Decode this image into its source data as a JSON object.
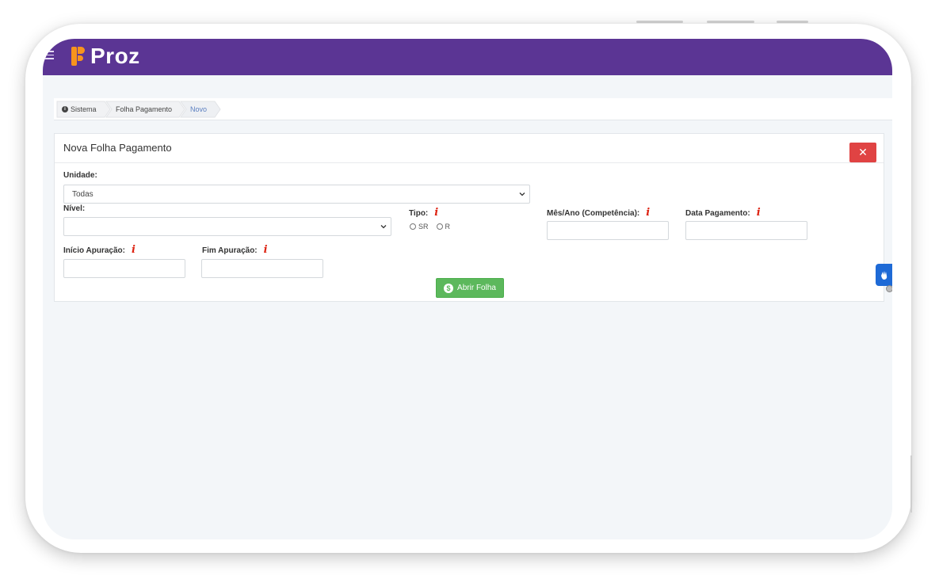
{
  "app": {
    "logo_text": "Proz"
  },
  "breadcrumb": {
    "items": [
      "Sistema",
      "Folha Pagamento",
      "Novo"
    ]
  },
  "form": {
    "title": "Nova Folha Pagamento",
    "close_label": "✕",
    "unidade": {
      "label": "Unidade:",
      "value": "Todas"
    },
    "nivel": {
      "label": "Nível:",
      "value": ""
    },
    "tipo": {
      "label": "Tipo:",
      "options": [
        "SR",
        "R"
      ]
    },
    "mes_ano": {
      "label": "Mês/Ano (Competência):",
      "value": ""
    },
    "data_pagamento": {
      "label": "Data Pagamento:",
      "value": ""
    },
    "inicio_apuracao": {
      "label": "Início Apuração:",
      "value": ""
    },
    "fim_apuracao": {
      "label": "Fim Apuração:",
      "value": ""
    },
    "required_marker": "i",
    "submit_label": "Abrir Folha"
  },
  "colors": {
    "topbar": "#5b3594",
    "logo_accent": "#f7941d",
    "close": "#e04343",
    "submit": "#5cb85c",
    "accessibility": "#1e6ad6"
  },
  "icons": {
    "menu": "hamburger-icon",
    "breadcrumb_home": "info-circle-icon",
    "close": "close-icon",
    "submit": "dollar-coin-icon",
    "accessibility": "sign-language-icon"
  }
}
